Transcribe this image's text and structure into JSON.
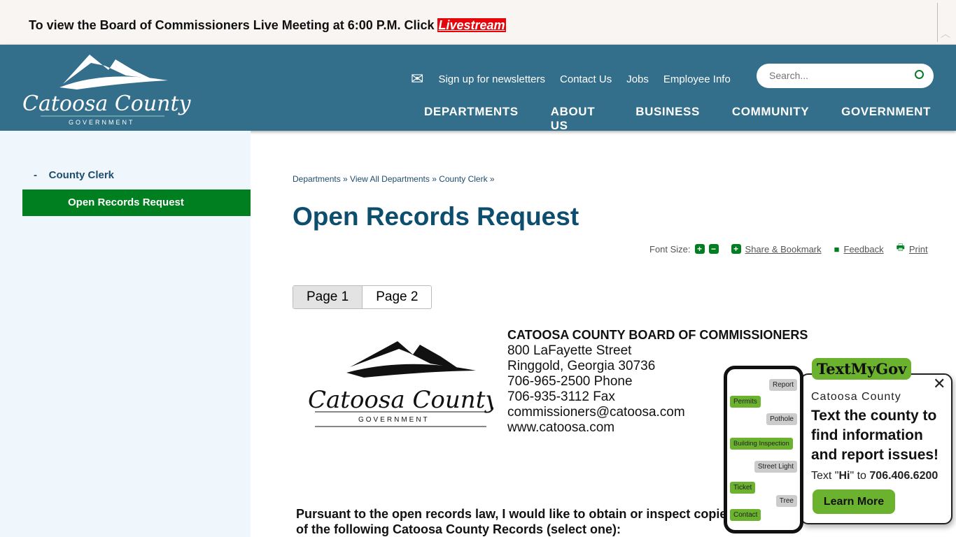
{
  "alert": {
    "text": "To view the Board of Commissioners Live Meeting at 6:00 P.M.  Click ",
    "link": "Livestream"
  },
  "header": {
    "logo_text": "Catoosa County",
    "logo_sub": "GOVERNMENT",
    "util": [
      "Sign up for newsletters",
      "Contact Us",
      "Jobs",
      "Employee Info"
    ],
    "search_placeholder": "Search...",
    "nav": [
      "DEPARTMENTS",
      "ABOUT US",
      "BUSINESS",
      "COMMUNITY",
      "GOVERNMENT"
    ],
    "active_nav": "DEPARTMENTS"
  },
  "sidebar": {
    "parent": "County Clerk",
    "active": "Open Records Request"
  },
  "breadcrumb": "Departments » View All Departments » County Clerk »",
  "title": "Open Records Request",
  "tools": {
    "font_size": "Font Size:",
    "share": "Share & Bookmark",
    "feedback": "Feedback",
    "print": "Print"
  },
  "tabs": [
    "Page 1",
    "Page 2"
  ],
  "address": {
    "org": "CATOOSA COUNTY BOARD OF COMMISSIONERS",
    "lines": [
      "800 LaFayette Street",
      "Ringgold, Georgia 30736",
      "706-965-2500 Phone",
      "706-935-3112 Fax",
      "commissioners@catoosa.com",
      "www.catoosa.com"
    ]
  },
  "pursuant": "Pursuant to the open records law, I would like to obtain or inspect copies of the following Catoosa County Records (select one):",
  "textmygov": {
    "brand": "TextMyGov",
    "county": "Catoosa County",
    "headline": "Text the county to find information and report issues!",
    "text_pre": "Text \"",
    "hi": "Hi",
    "text_mid": "\" to ",
    "number": "706.406.6200",
    "button": "Learn More",
    "bubbles": [
      "Report",
      "Permits",
      "Pothole",
      "Building Inspection",
      "Street Light",
      "Ticket",
      "Tree",
      "Contact"
    ]
  },
  "colors": {
    "header": "#336e8a",
    "green": "#007f20",
    "title": "#0d4d6e",
    "tmg_green": "#6bb32e"
  }
}
